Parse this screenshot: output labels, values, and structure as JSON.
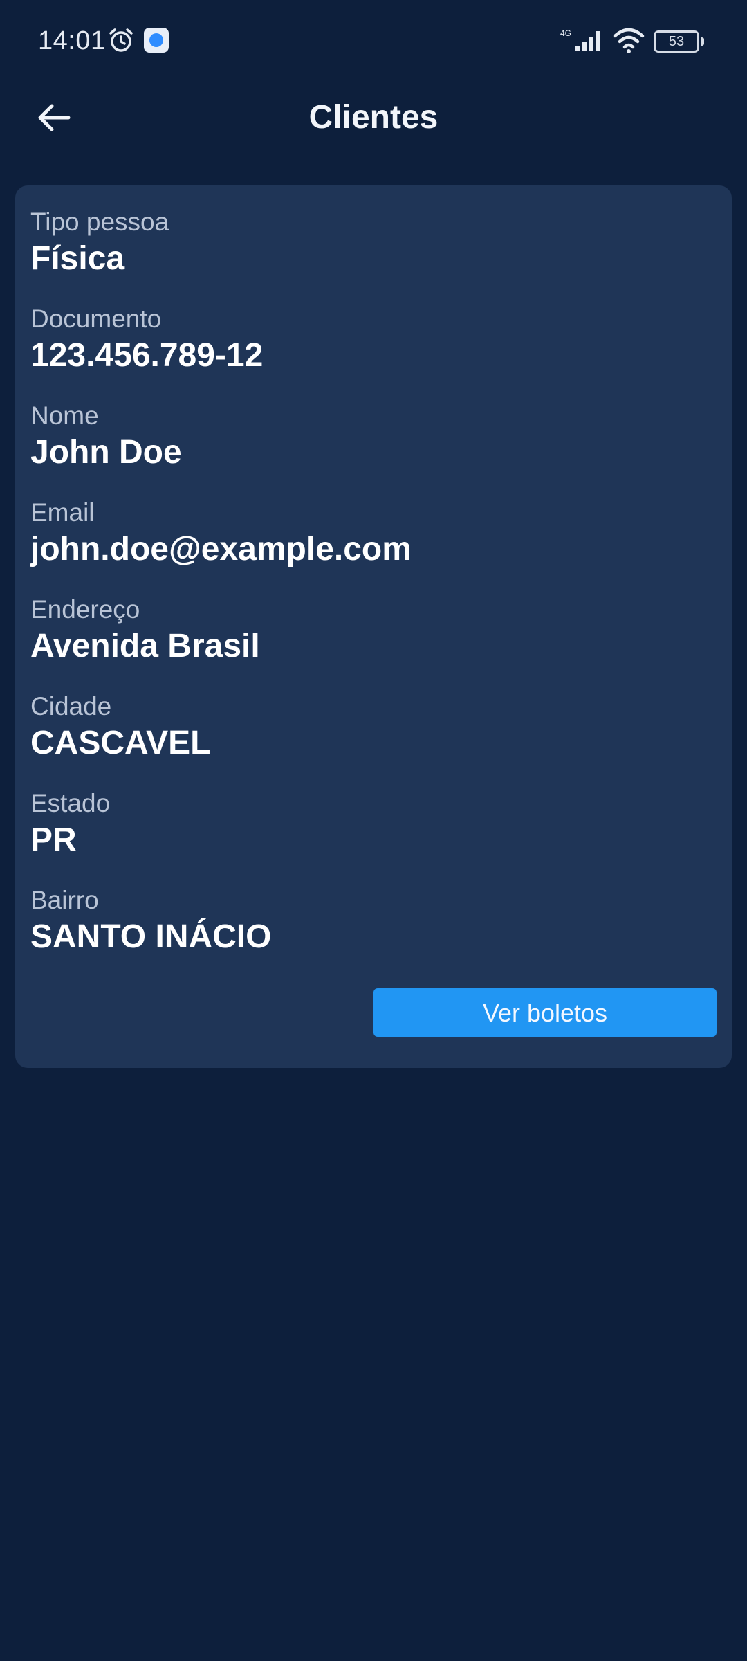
{
  "status_bar": {
    "time": "14:01",
    "network": "4G",
    "battery": "53",
    "icons": [
      "alarm-icon",
      "app-notification-icon",
      "signal-icon",
      "wifi-icon",
      "battery-icon"
    ]
  },
  "app_bar": {
    "title": "Clientes",
    "back_icon": "arrow-left-icon"
  },
  "client": {
    "fields": [
      {
        "label": "Tipo pessoa",
        "value": "Física"
      },
      {
        "label": "Documento",
        "value": "123.456.789-12"
      },
      {
        "label": "Nome",
        "value": "John Doe"
      },
      {
        "label": "Email",
        "value": "john.doe@example.com"
      },
      {
        "label": "Endereço",
        "value": "Avenida Brasil"
      },
      {
        "label": "Cidade",
        "value": "CASCAVEL"
      },
      {
        "label": "Estado",
        "value": "PR"
      },
      {
        "label": "Bairro",
        "value": "SANTO INÁCIO"
      }
    ],
    "action_label": "Ver boletos"
  },
  "colors": {
    "background": "#0d1f3c",
    "card": "#1f3557",
    "accent": "#2196f3",
    "label_text": "#b9c4d6",
    "value_text": "#ffffff"
  }
}
